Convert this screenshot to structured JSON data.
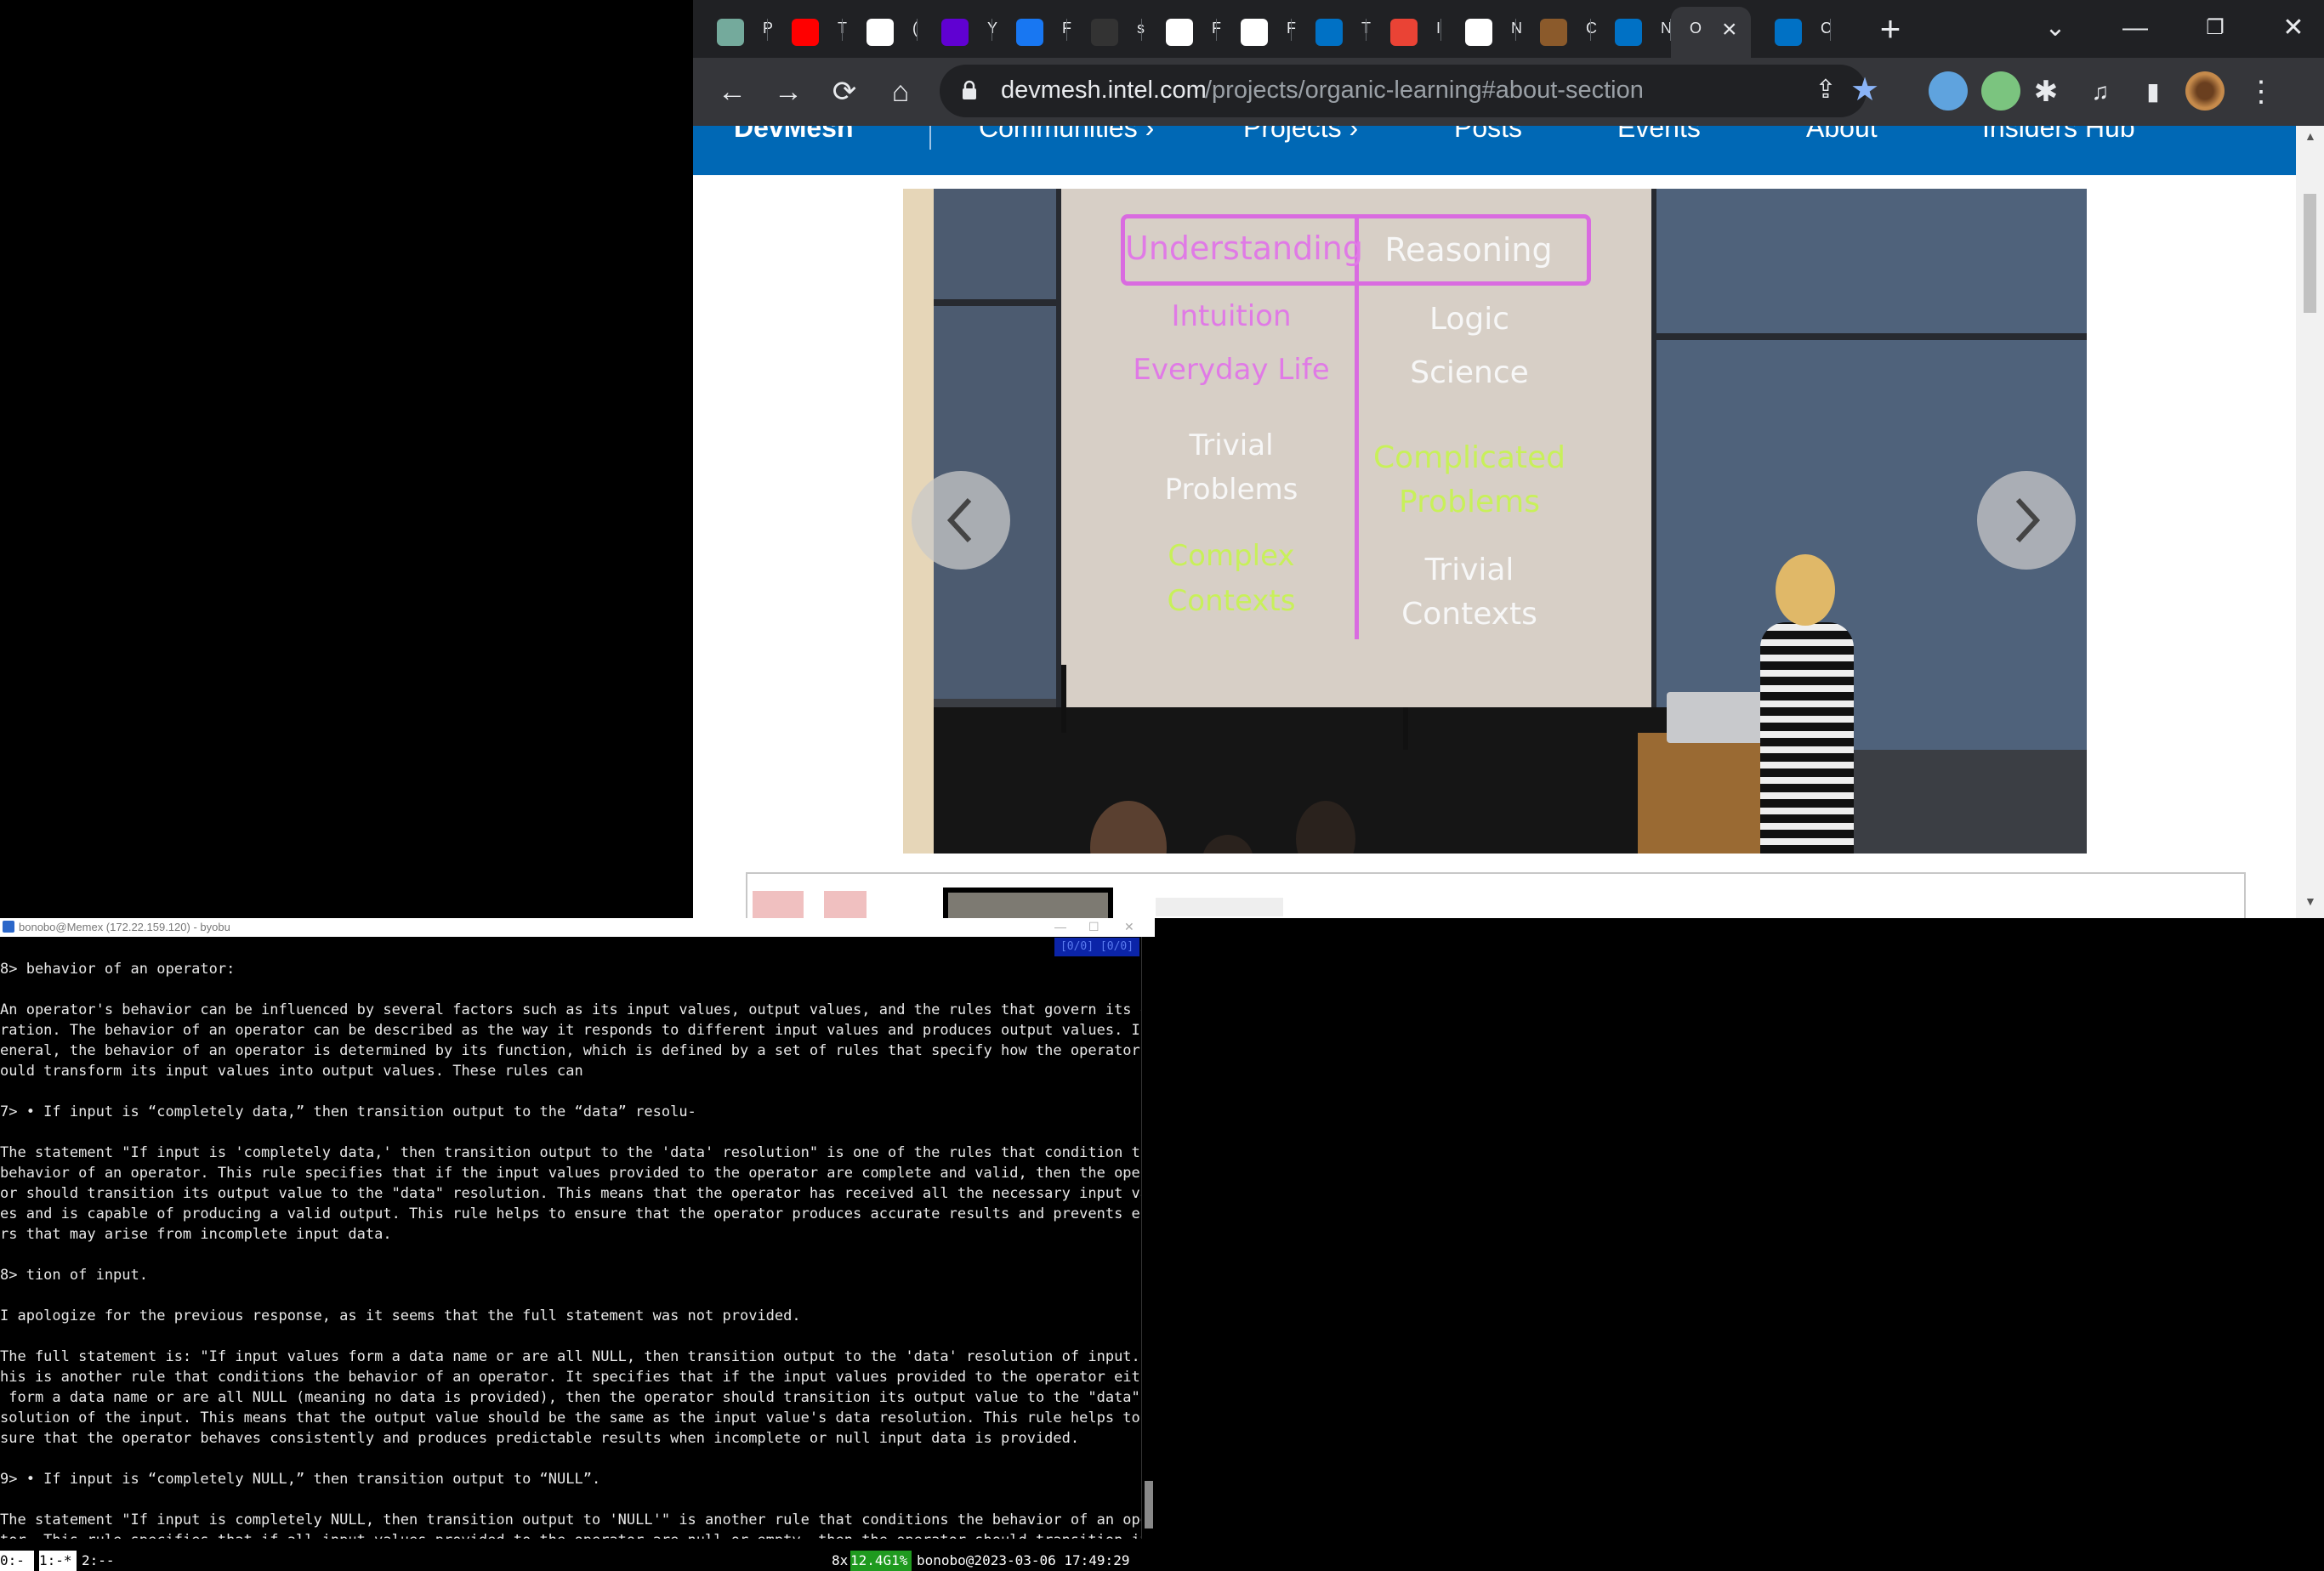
{
  "browser": {
    "tabs": [
      {
        "icon": "chatgpt-icon",
        "label": "P",
        "color": "#74aa9c"
      },
      {
        "icon": "youtube-icon",
        "label": "T",
        "color": "#ff0000"
      },
      {
        "icon": "globe-icon",
        "label": "(",
        "color": "#ffffff"
      },
      {
        "icon": "yahoo-icon",
        "label": "Y",
        "color": "#6001d2"
      },
      {
        "icon": "facebook-icon",
        "label": "F",
        "color": "#1877f2"
      },
      {
        "icon": "github-icon",
        "label": "s",
        "color": "#333333"
      },
      {
        "icon": "wikipedia-icon",
        "label": "F",
        "color": "#ffffff"
      },
      {
        "icon": "wikipedia-icon",
        "label": "F",
        "color": "#ffffff"
      },
      {
        "icon": "intel-icon",
        "label": "T",
        "color": "#0071c5"
      },
      {
        "icon": "gmail-icon",
        "label": "I",
        "color": "#ea4335"
      },
      {
        "icon": "chrome-icon",
        "label": "N",
        "color": "#ffffff"
      },
      {
        "icon": "mascot-icon",
        "label": "C",
        "color": "#8b5a2b"
      },
      {
        "icon": "intel-icon",
        "label": "N",
        "color": "#0071c5"
      },
      {
        "icon": "",
        "label": "O",
        "color": "#35363a",
        "active": true
      },
      {
        "icon": "intel-icon",
        "label": "C",
        "color": "#0071c5"
      }
    ],
    "url_host": "devmesh.intel.com",
    "url_path": "/projects/organic-learning#about-section"
  },
  "site": {
    "nav": {
      "brand": "DevMesh",
      "items": [
        "Communities ›",
        "Projects ›",
        "Posts",
        "Events",
        "About",
        "Insiders Hub"
      ]
    },
    "slide": {
      "left_header": "Understanding",
      "right_header": "Reasoning",
      "left": {
        "line1": "Intuition",
        "line2": "Everyday Life",
        "trivial1": "Trivial",
        "trivial2": "Problems",
        "complex1": "Complex",
        "complex2": "Contexts"
      },
      "right": {
        "line1": "Logic",
        "line2": "Science",
        "complicated1": "Complicated",
        "complicated2": "Problems",
        "trivial1": "Trivial",
        "trivial2": "Contexts"
      }
    }
  },
  "terminal": {
    "title": "bonobo@Memex (172.22.159.120) - byobu",
    "badge": "[0/0] [0/0]",
    "lines": [
      "8> behavior of an operator:",
      "",
      "An operator's behavior can be influenced by several factors such as its input values, output values, and the rules that govern its ope",
      "ration. The behavior of an operator can be described as the way it responds to different input values and produces output values. In g",
      "eneral, the behavior of an operator is determined by its function, which is defined by a set of rules that specify how the operator sh",
      "ould transform its input values into output values. These rules can",
      "",
      "7> • If input is “completely data,” then transition output to the “data” resolu-",
      "",
      "The statement \"If input is 'completely data,' then transition output to the 'data' resolution\" is one of the rules that condition the",
      "behavior of an operator. This rule specifies that if the input values provided to the operator are complete and valid, then the operat",
      "or should transition its output value to the \"data\" resolution. This means that the operator has received all the necessary input valu",
      "es and is capable of producing a valid output. This rule helps to ensure that the operator produces accurate results and prevents erro",
      "rs that may arise from incomplete input data.",
      "",
      "8> tion of input.",
      "",
      "I apologize for the previous response, as it seems that the full statement was not provided.",
      "",
      "The full statement is: \"If input values form a data name or are all NULL, then transition output to the 'data' resolution of input.\" T",
      "his is another rule that conditions the behavior of an operator. It specifies that if the input values provided to the operator either",
      " form a data name or are all NULL (meaning no data is provided), then the operator should transition its output value to the \"data\" re",
      "solution of the input. This means that the output value should be the same as the input value's data resolution. This rule helps to en",
      "sure that the operator behaves consistently and produces predictable results when incomplete or null input data is provided.",
      "",
      "9> • If input is “completely NULL,” then transition output to “NULL”.",
      "",
      "The statement \"If input is completely NULL, then transition output to 'NULL'\" is another rule that conditions the behavior of an opera",
      "tor. This rule specifies that if all input values provided to the operator are null or empty, then the operator should transition its"
    ],
    "status": {
      "win0": "0:-",
      "win1": "1:-*",
      "win2": "2:--",
      "load": "8x",
      "mem": "12.4G1%",
      "host_time": "bonobo@2023-03-06 17:49:29"
    }
  }
}
